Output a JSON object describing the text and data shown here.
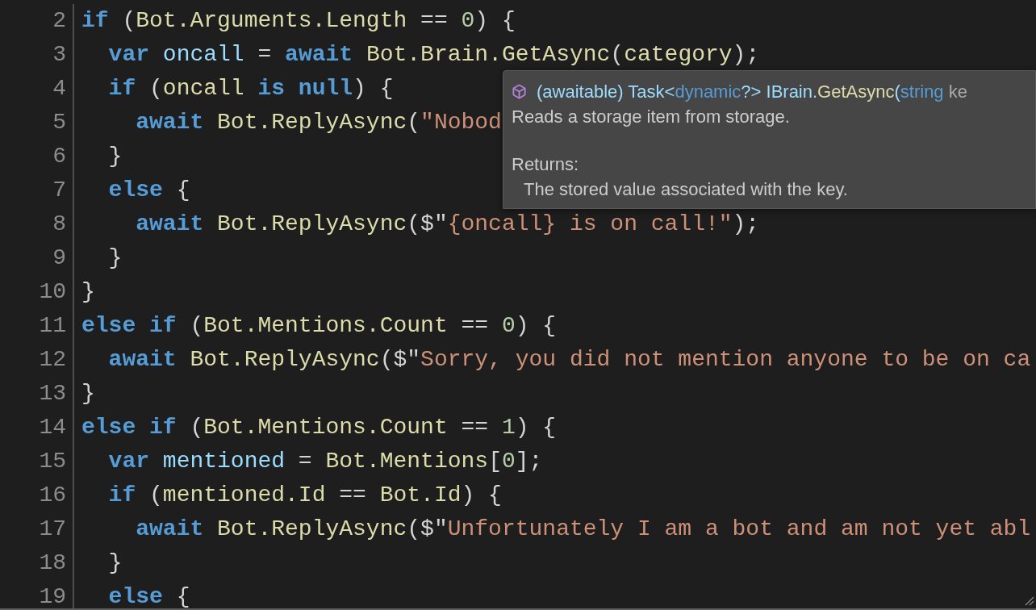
{
  "editor": {
    "lines": [
      {
        "number": "2",
        "tokens": [
          {
            "kind": "keyword",
            "text": "if"
          },
          {
            "kind": "punct",
            "text": " ("
          },
          {
            "kind": "ident",
            "text": "Bot.Arguments.Length"
          },
          {
            "kind": "punct",
            "text": " == "
          },
          {
            "kind": "number",
            "text": "0"
          },
          {
            "kind": "punct",
            "text": ") {"
          }
        ]
      },
      {
        "number": "3",
        "tokens": [
          {
            "kind": "keyword",
            "text": "  var "
          },
          {
            "kind": "variable",
            "text": "oncall"
          },
          {
            "kind": "punct",
            "text": " = "
          },
          {
            "kind": "keyword",
            "text": "await "
          },
          {
            "kind": "ident",
            "text": "Bot.Brain.GetAsync"
          },
          {
            "kind": "punct",
            "text": "("
          },
          {
            "kind": "ident",
            "text": "category"
          },
          {
            "kind": "punct",
            "text": ");"
          }
        ]
      },
      {
        "number": "4",
        "tokens": [
          {
            "kind": "keyword",
            "text": "  if"
          },
          {
            "kind": "punct",
            "text": " ("
          },
          {
            "kind": "ident",
            "text": "oncall "
          },
          {
            "kind": "keyword",
            "text": "is null"
          },
          {
            "kind": "punct",
            "text": ") {"
          }
        ]
      },
      {
        "number": "5",
        "tokens": [
          {
            "kind": "keyword",
            "text": "    await "
          },
          {
            "kind": "ident",
            "text": "Bot.ReplyAsync"
          },
          {
            "kind": "punct",
            "text": "("
          },
          {
            "kind": "string",
            "text": "\"Nobod"
          }
        ]
      },
      {
        "number": "6",
        "tokens": [
          {
            "kind": "punct",
            "text": "  }"
          }
        ]
      },
      {
        "number": "7",
        "tokens": [
          {
            "kind": "keyword",
            "text": "  else"
          },
          {
            "kind": "punct",
            "text": " {"
          }
        ]
      },
      {
        "number": "8",
        "tokens": [
          {
            "kind": "keyword",
            "text": "    await "
          },
          {
            "kind": "ident",
            "text": "Bot.ReplyAsync"
          },
          {
            "kind": "punct",
            "text": "($\""
          },
          {
            "kind": "string",
            "text": "{oncall} is on call!\""
          },
          {
            "kind": "punct",
            "text": ");"
          }
        ]
      },
      {
        "number": "9",
        "tokens": [
          {
            "kind": "punct",
            "text": "  }"
          }
        ]
      },
      {
        "number": "10",
        "tokens": [
          {
            "kind": "punct",
            "text": "}"
          }
        ]
      },
      {
        "number": "11",
        "tokens": [
          {
            "kind": "keyword",
            "text": "else if"
          },
          {
            "kind": "punct",
            "text": " ("
          },
          {
            "kind": "ident",
            "text": "Bot.Mentions.Count"
          },
          {
            "kind": "punct",
            "text": " == "
          },
          {
            "kind": "number",
            "text": "0"
          },
          {
            "kind": "punct",
            "text": ") {"
          }
        ]
      },
      {
        "number": "12",
        "tokens": [
          {
            "kind": "keyword",
            "text": "  await "
          },
          {
            "kind": "ident",
            "text": "Bot.ReplyAsync"
          },
          {
            "kind": "punct",
            "text": "($\""
          },
          {
            "kind": "string",
            "text": "Sorry, you did not mention anyone to be on ca"
          }
        ]
      },
      {
        "number": "13",
        "tokens": [
          {
            "kind": "punct",
            "text": "}"
          }
        ]
      },
      {
        "number": "14",
        "tokens": [
          {
            "kind": "keyword",
            "text": "else if"
          },
          {
            "kind": "punct",
            "text": " ("
          },
          {
            "kind": "ident",
            "text": "Bot.Mentions.Count"
          },
          {
            "kind": "punct",
            "text": " == "
          },
          {
            "kind": "number",
            "text": "1"
          },
          {
            "kind": "punct",
            "text": ") {"
          }
        ]
      },
      {
        "number": "15",
        "tokens": [
          {
            "kind": "keyword",
            "text": "  var "
          },
          {
            "kind": "variable",
            "text": "mentioned"
          },
          {
            "kind": "punct",
            "text": " = "
          },
          {
            "kind": "ident",
            "text": "Bot.Mentions"
          },
          {
            "kind": "punct",
            "text": "["
          },
          {
            "kind": "number",
            "text": "0"
          },
          {
            "kind": "punct",
            "text": "];"
          }
        ]
      },
      {
        "number": "16",
        "tokens": [
          {
            "kind": "keyword",
            "text": "  if"
          },
          {
            "kind": "punct",
            "text": " ("
          },
          {
            "kind": "ident",
            "text": "mentioned.Id"
          },
          {
            "kind": "punct",
            "text": " == "
          },
          {
            "kind": "ident",
            "text": "Bot.Id"
          },
          {
            "kind": "punct",
            "text": ") {"
          }
        ]
      },
      {
        "number": "17",
        "tokens": [
          {
            "kind": "keyword",
            "text": "    await "
          },
          {
            "kind": "ident",
            "text": "Bot.ReplyAsync"
          },
          {
            "kind": "punct",
            "text": "($\""
          },
          {
            "kind": "string",
            "text": "Unfortunately I am a bot and am not yet abl"
          }
        ]
      },
      {
        "number": "18",
        "tokens": [
          {
            "kind": "punct",
            "text": "  }"
          }
        ]
      },
      {
        "number": "19",
        "tokens": [
          {
            "kind": "keyword",
            "text": "  else"
          },
          {
            "kind": "punct",
            "text": " {"
          }
        ]
      }
    ]
  },
  "tooltip": {
    "signature": [
      {
        "kind": "type",
        "text": "(awaitable) Task<"
      },
      {
        "kind": "keyword",
        "text": "dynamic"
      },
      {
        "kind": "type",
        "text": "?> IBrain."
      },
      {
        "kind": "method",
        "text": "GetAsync"
      },
      {
        "kind": "type",
        "text": "("
      },
      {
        "kind": "keyword",
        "text": "string"
      },
      {
        "kind": "param",
        "text": " ke"
      }
    ],
    "description": "Reads a storage item from storage.",
    "returns_label": "Returns:",
    "returns": "The stored value associated with the key."
  }
}
